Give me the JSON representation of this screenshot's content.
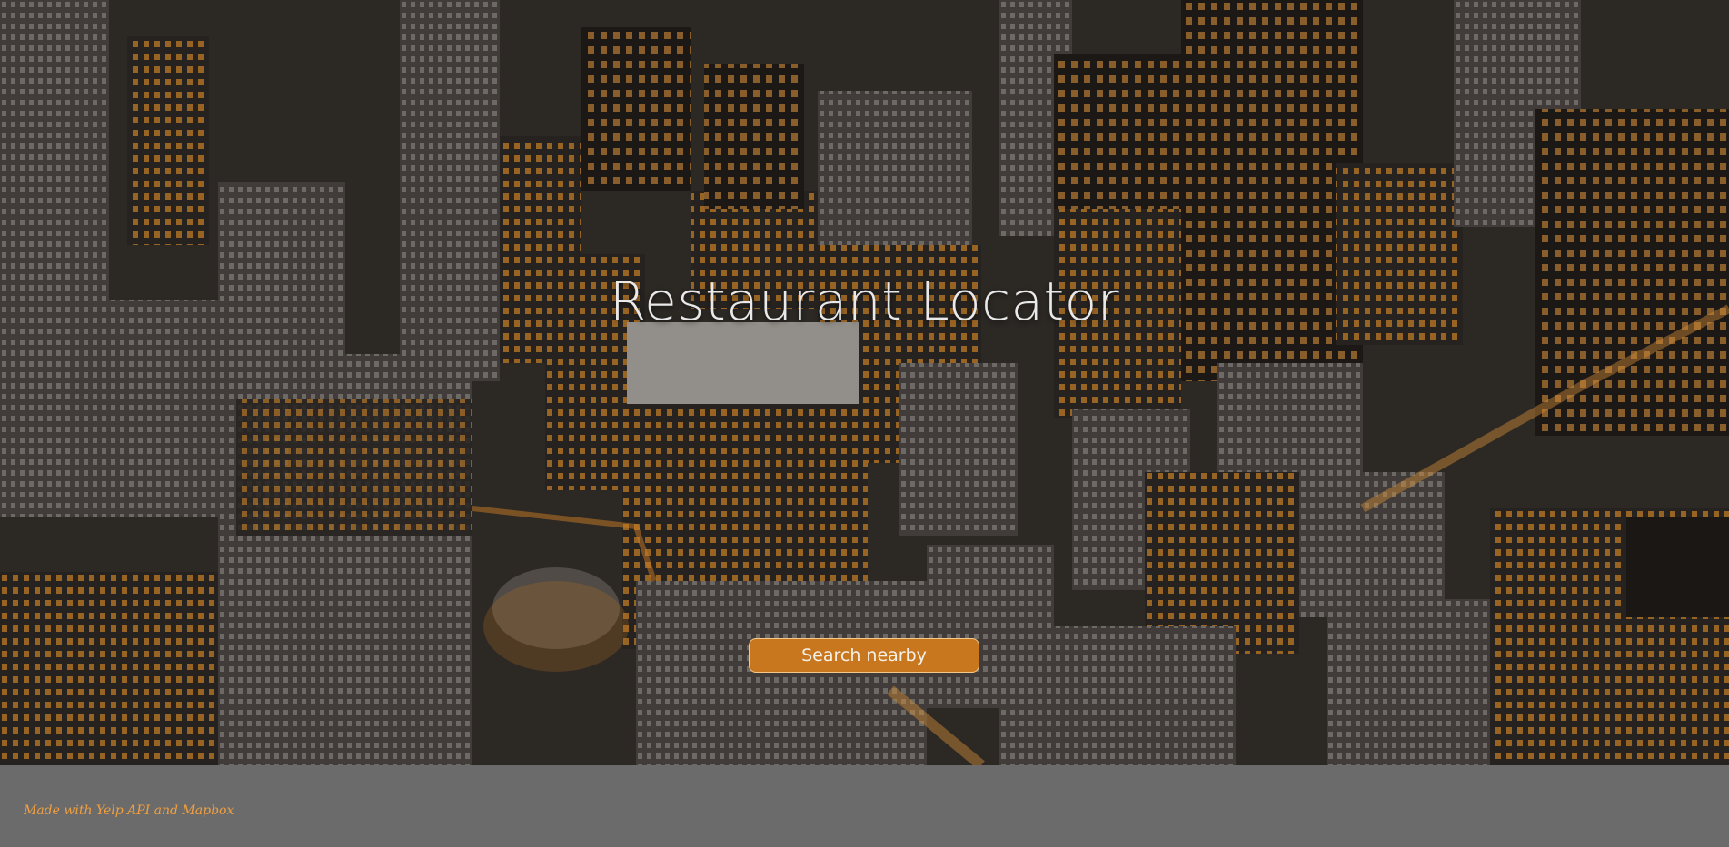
{
  "hero": {
    "title": "Restaurant Locator",
    "search_button_label": "Search nearby"
  },
  "footer": {
    "credit": "Made with Yelp API and Mapbox"
  },
  "colors": {
    "accent": "#c8771f",
    "footer_bg": "#6b6b6b",
    "credit_text": "#f0a040",
    "title_text": "#e9e9e9"
  }
}
